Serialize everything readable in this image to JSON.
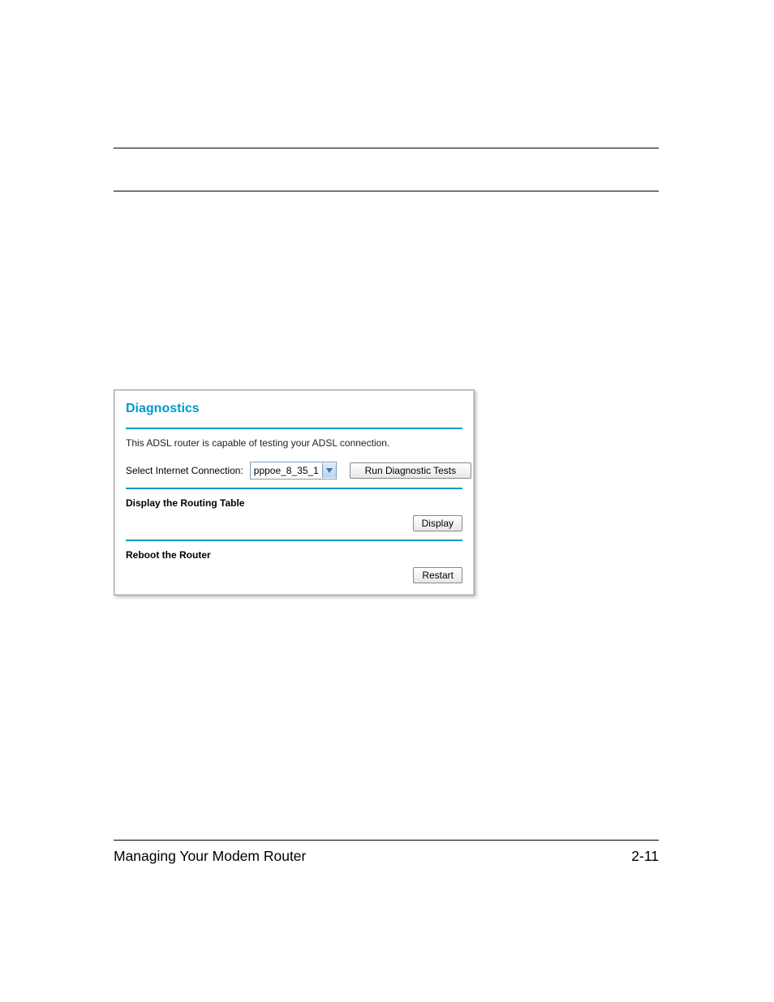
{
  "footer": {
    "left": "Managing Your Modem Router",
    "right": "2-11"
  },
  "panel": {
    "title": "Diagnostics",
    "description": "This ADSL router is capable of testing your ADSL connection.",
    "select_label": "Select Internet Connection:",
    "select_value": "pppoe_8_35_1",
    "run_tests_btn": "Run Diagnostic Tests",
    "routing_heading": "Display the Routing Table",
    "display_btn": "Display",
    "reboot_heading": "Reboot the Router",
    "restart_btn": "Restart"
  }
}
